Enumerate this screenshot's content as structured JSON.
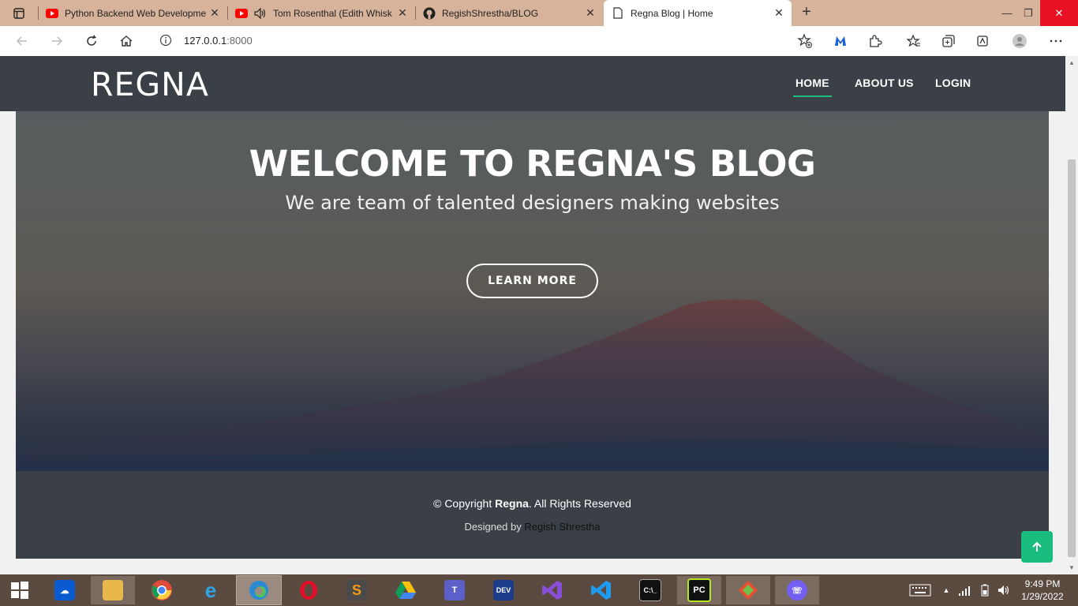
{
  "browser": {
    "tabs": [
      {
        "title": "Python Backend Web Developme",
        "icon": "youtube-icon"
      },
      {
        "title": "Tom Rosenthal (Edith Whisk",
        "icon": "youtube-icon"
      },
      {
        "title": "RegishShrestha/BLOG",
        "icon": "github-icon"
      },
      {
        "title": "Regna Blog | Home",
        "icon": "page-icon"
      }
    ],
    "url_host": "127.0.0.1",
    "url_port": ":8000"
  },
  "site": {
    "logo": "REGNA",
    "nav": {
      "home": "HOME",
      "about": "ABOUT US",
      "login": "LOGIN"
    },
    "hero": {
      "title": "WELCOME TO REGNA'S BLOG",
      "subtitle": "We are team of talented designers making websites",
      "cta": "LEARN MORE"
    },
    "footer": {
      "copyright_prefix": "© Copyright ",
      "brand": "Regna",
      "copyright_suffix": ". All Rights Reserved",
      "designed_prefix": "Designed by ",
      "designer": "Regish Shrestha"
    }
  },
  "taskbar": {
    "time": "9:49 PM",
    "date": "1/29/2022"
  },
  "colors": {
    "accent": "#1bbd7e",
    "header": "#3a4046",
    "chrome": "#d8b39b"
  }
}
